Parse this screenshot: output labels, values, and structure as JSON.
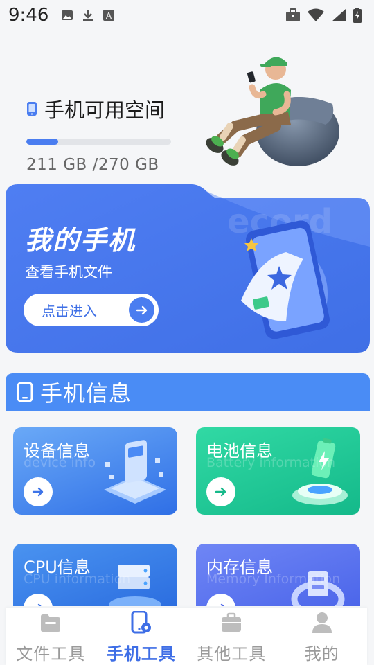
{
  "status_bar": {
    "time": "9:46",
    "left_icons": [
      "image-icon",
      "download-icon",
      "a-icon"
    ],
    "right_icons": [
      "briefcase-icon",
      "wifi-icon",
      "signal-icon",
      "battery-charging-icon"
    ]
  },
  "storage": {
    "title": "手机可用空间",
    "used_fraction": 0.22,
    "value_text": "211 GB /270 GB"
  },
  "my_phone_card": {
    "title": "我的手机",
    "subtitle": "查看手机文件",
    "button_label": "点击进入",
    "watermark": "ecord"
  },
  "phone_info": {
    "title": "手机信息",
    "tiles": [
      {
        "title": "设备信息",
        "subtitle": "device info"
      },
      {
        "title": "电池信息",
        "subtitle": "Battery information"
      },
      {
        "title": "CPU信息",
        "subtitle": "CPU information"
      },
      {
        "title": "内存信息",
        "subtitle": "Memory Information"
      }
    ]
  },
  "bottom_nav": {
    "items": [
      {
        "label": "文件工具",
        "icon": "folder-icon",
        "active": false
      },
      {
        "label": "手机工具",
        "icon": "phone-settings-icon",
        "active": true
      },
      {
        "label": "其他工具",
        "icon": "toolbox-icon",
        "active": false
      },
      {
        "label": "我的",
        "icon": "user-icon",
        "active": false
      }
    ]
  },
  "colors": {
    "accent": "#4a7df0",
    "section_header": "#4a8cf5",
    "battery_green": "#14b98a"
  }
}
